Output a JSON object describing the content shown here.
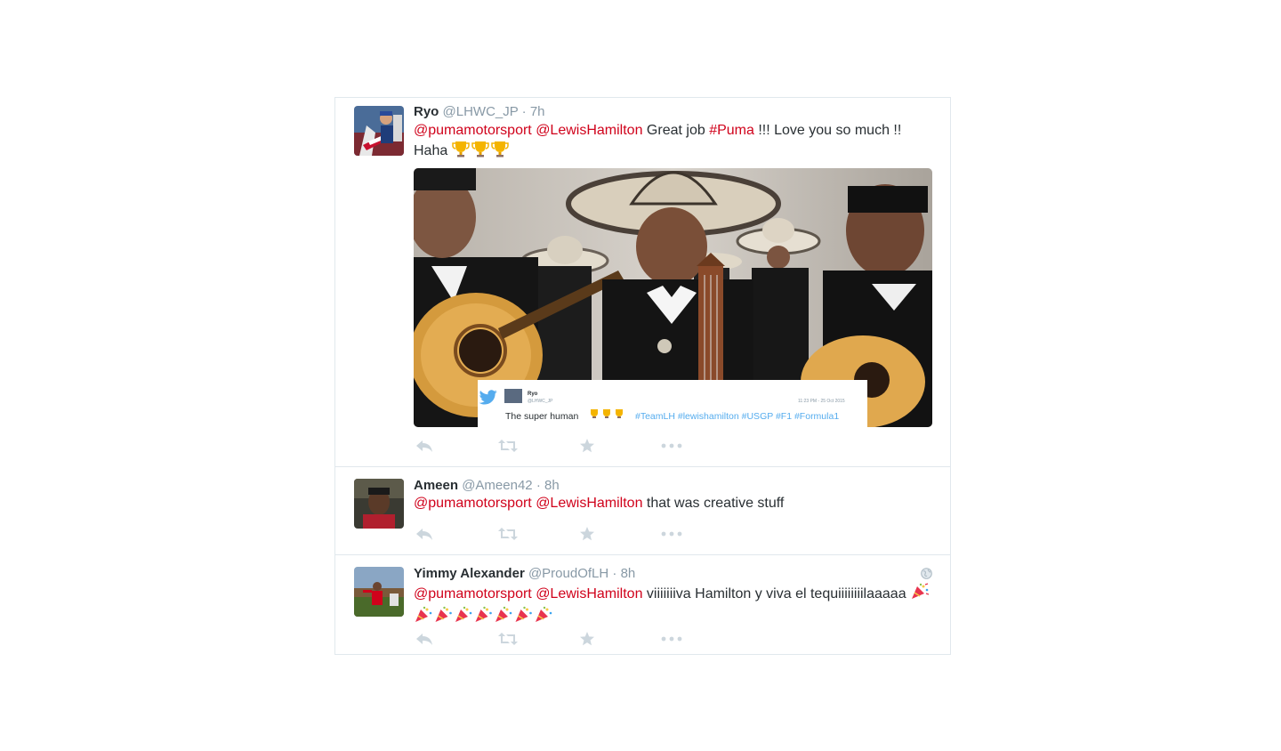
{
  "colors": {
    "accent": "#d0021b",
    "muted": "#8899a6",
    "text": "#292f33",
    "border": "#e1e8ed",
    "icon": "#ccd6dd"
  },
  "icons": [
    "reply-icon",
    "retweet-icon",
    "like-icon",
    "more-icon",
    "trophy-icon",
    "party-popper-icon",
    "globe-icon",
    "twitter-bird-icon"
  ],
  "tweets": [
    {
      "fullname": "Ryo",
      "username": "@LHWC_JP",
      "separator": "·",
      "time": "7h",
      "mention1": "@pumamotorsport",
      "mention2": "@LewisHamilton",
      "text_a": "Great job",
      "hashtag": "#Puma",
      "text_b": "!!! Love you so much !!",
      "text_c": "Haha",
      "trophies": 3,
      "media": {
        "embed_name": "Ryo",
        "embed_handle": "@LHWC_JP",
        "embed_time": "11:23 PM - 25 Oct 2015",
        "embed_text": "The super human",
        "embed_tags": "#TeamLH #lewishamilton #USGP #F1 #Formula1"
      }
    },
    {
      "fullname": "Ameen",
      "username": "@Ameen42",
      "separator": "·",
      "time": "8h",
      "mention1": "@pumamotorsport",
      "mention2": "@LewisHamilton",
      "text_a": "that was creative stuff"
    },
    {
      "fullname": "Yimmy Alexander",
      "username": "@ProudOfLH",
      "separator": "·",
      "time": "8h",
      "mention1": "@pumamotorsport",
      "mention2": "@LewisHamilton",
      "text_a": "viiiiiiiva Hamilton y viva el tequiiiiiiiilaaaaa",
      "party_poppers_line1": 1,
      "party_poppers_line2": 7
    }
  ]
}
